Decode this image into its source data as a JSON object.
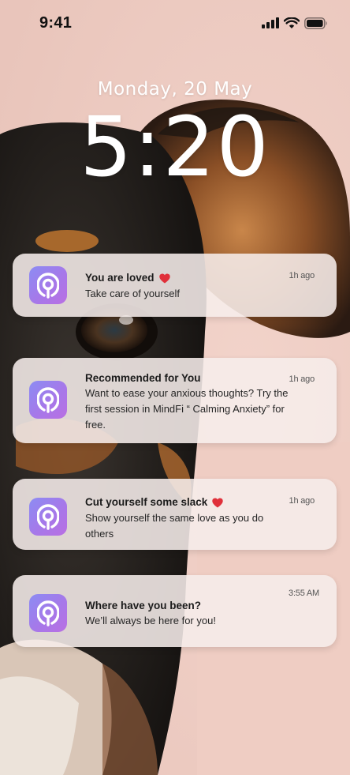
{
  "status_bar": {
    "time": "9:41",
    "icons": [
      "signal-icon",
      "wifi-icon",
      "battery-icon"
    ]
  },
  "lock_screen": {
    "date": "Monday,  20 May",
    "time": "5:20"
  },
  "notifications": [
    {
      "title": "You are loved",
      "body": "Take care of yourself",
      "time": "1h ago",
      "has_heart": true
    },
    {
      "title": "Recommended for You",
      "body": "Want to ease your anxious thoughts? Try the first session in MindFi “ Calming Anxiety” for free.",
      "time": "1h ago",
      "has_heart": false
    },
    {
      "title": "Cut yourself some slack",
      "body": "Show yourself the same love as you do others",
      "time": "1h ago",
      "has_heart": true
    },
    {
      "title": "Where have you been?",
      "body": "We’ll always be here for you!",
      "time": "3:55 AM",
      "has_heart": false
    }
  ],
  "colors": {
    "background": "#efcfc6",
    "app_icon_gradient_start": "#8c8cf3",
    "app_icon_gradient_end": "#b96fe3",
    "heart": "#e0303a"
  }
}
